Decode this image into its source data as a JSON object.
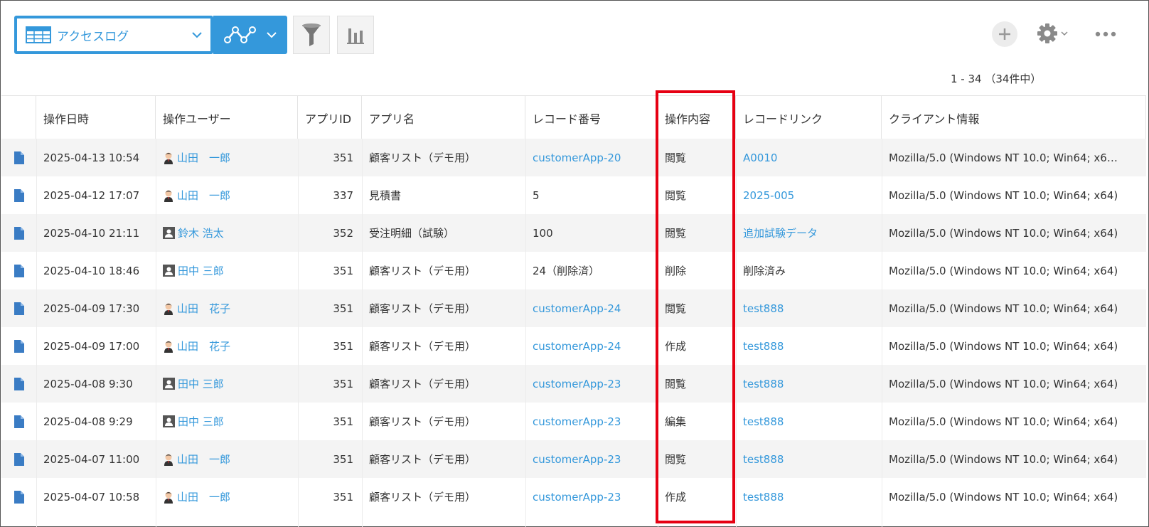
{
  "toolbar": {
    "view_name": "アクセスログ",
    "icons": [
      "table-grid-icon",
      "chevron-down-icon",
      "line-graph-icon",
      "filter-icon",
      "bar-chart-icon",
      "plus-icon",
      "gear-icon",
      "more-icon"
    ],
    "accent_color": "#3498db"
  },
  "pager": {
    "text": "1 - 34 （34件中）"
  },
  "table": {
    "headers": [
      "操作日時",
      "操作ユーザー",
      "アプリID",
      "アプリ名",
      "レコード番号",
      "操作内容",
      "レコードリンク",
      "クライアント情報"
    ],
    "rows": [
      {
        "datetime": "2025-04-13 10:54",
        "user": "山田　一郎",
        "avatar": "person",
        "app_id": "351",
        "app_name": "顧客リスト（デモ用）",
        "record_no": "customerApp-20",
        "record_is_link": true,
        "operation": "閲覧",
        "record_link": "A0010",
        "link_is_link": true,
        "client": "Mozilla/5.0 (Windows NT 10.0; Win64; x6…"
      },
      {
        "datetime": "2025-04-12 17:07",
        "user": "山田　一郎",
        "avatar": "person",
        "app_id": "337",
        "app_name": "見積書",
        "record_no": "5",
        "record_is_link": false,
        "operation": "閲覧",
        "record_link": "2025-005",
        "link_is_link": true,
        "client": "Mozilla/5.0 (Windows NT 10.0; Win64; x64)"
      },
      {
        "datetime": "2025-04-10 21:11",
        "user": "鈴木 浩太",
        "avatar": "box",
        "app_id": "352",
        "app_name": "受注明細（試験）",
        "record_no": "100",
        "record_is_link": false,
        "operation": "閲覧",
        "record_link": "追加試験データ",
        "link_is_link": true,
        "client": "Mozilla/5.0 (Windows NT 10.0; Win64; x64)"
      },
      {
        "datetime": "2025-04-10 18:46",
        "user": "田中 三郎",
        "avatar": "box",
        "app_id": "351",
        "app_name": "顧客リスト（デモ用）",
        "record_no": "24（削除済）",
        "record_is_link": false,
        "operation": "削除",
        "record_link": "削除済み",
        "link_is_link": false,
        "client": "Mozilla/5.0 (Windows NT 10.0; Win64; x64)"
      },
      {
        "datetime": "2025-04-09 17:30",
        "user": "山田　花子",
        "avatar": "person",
        "app_id": "351",
        "app_name": "顧客リスト（デモ用）",
        "record_no": "customerApp-24",
        "record_is_link": true,
        "operation": "閲覧",
        "record_link": "test888",
        "link_is_link": true,
        "client": "Mozilla/5.0 (Windows NT 10.0; Win64; x64)"
      },
      {
        "datetime": "2025-04-09 17:00",
        "user": "山田　花子",
        "avatar": "person",
        "app_id": "351",
        "app_name": "顧客リスト（デモ用）",
        "record_no": "customerApp-24",
        "record_is_link": true,
        "operation": "作成",
        "record_link": "test888",
        "link_is_link": true,
        "client": "Mozilla/5.0 (Windows NT 10.0; Win64; x64)"
      },
      {
        "datetime": "2025-04-08 9:30",
        "user": "田中 三郎",
        "avatar": "box",
        "app_id": "351",
        "app_name": "顧客リスト（デモ用）",
        "record_no": "customerApp-23",
        "record_is_link": true,
        "operation": "閲覧",
        "record_link": "test888",
        "link_is_link": true,
        "client": "Mozilla/5.0 (Windows NT 10.0; Win64; x64)"
      },
      {
        "datetime": "2025-04-08 9:29",
        "user": "田中 三郎",
        "avatar": "box",
        "app_id": "351",
        "app_name": "顧客リスト（デモ用）",
        "record_no": "customerApp-23",
        "record_is_link": true,
        "operation": "編集",
        "record_link": "test888",
        "link_is_link": true,
        "client": "Mozilla/5.0 (Windows NT 10.0; Win64; x64)"
      },
      {
        "datetime": "2025-04-07 11:00",
        "user": "山田　一郎",
        "avatar": "person",
        "app_id": "351",
        "app_name": "顧客リスト（デモ用）",
        "record_no": "customerApp-23",
        "record_is_link": true,
        "operation": "閲覧",
        "record_link": "test888",
        "link_is_link": true,
        "client": "Mozilla/5.0 (Windows NT 10.0; Win64; x64)"
      },
      {
        "datetime": "2025-04-07 10:58",
        "user": "山田　一郎",
        "avatar": "person",
        "app_id": "351",
        "app_name": "顧客リスト（デモ用）",
        "record_no": "customerApp-23",
        "record_is_link": true,
        "operation": "作成",
        "record_link": "test888",
        "link_is_link": true,
        "client": "Mozilla/5.0 (Windows NT 10.0; Win64; x64)"
      }
    ]
  },
  "highlight": {
    "column": "操作内容",
    "color": "#e60012"
  }
}
